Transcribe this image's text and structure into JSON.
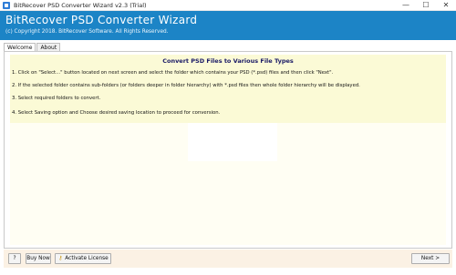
{
  "window": {
    "title": "BitRecover PSD Converter Wizard v2.3 (Trial)",
    "controls": {
      "minimize": "—",
      "maximize": "☐",
      "close": "✕"
    }
  },
  "header": {
    "app_title": "BitRecover PSD Converter Wizard",
    "copyright": "(c) Copyright 2018. BitRecover Software. All Rights Reserved.",
    "background_color": "#1c84c6"
  },
  "tabs": [
    {
      "label": "Welcome",
      "active": true
    },
    {
      "label": "About",
      "active": false
    }
  ],
  "instructions": {
    "title": "Convert PSD Files to Various File Types",
    "steps": [
      "1. Click on \"Select...\" button located on next screen and select the folder which contains your PSD (*.psd) files and then click \"Next\".",
      "2. If the selected folder contains sub-folders (or folders deeper in folder hierarchy) with *.psd files then whole folder hierarchy will be displayed.",
      "3. Select required folders to convert.",
      "4. Select Saving option and Choose desired saving location to proceed for conversion."
    ]
  },
  "footer": {
    "help_label": "?",
    "buy_now_label": "Buy Now",
    "activate_label": "Activate License",
    "next_label": "Next >"
  }
}
